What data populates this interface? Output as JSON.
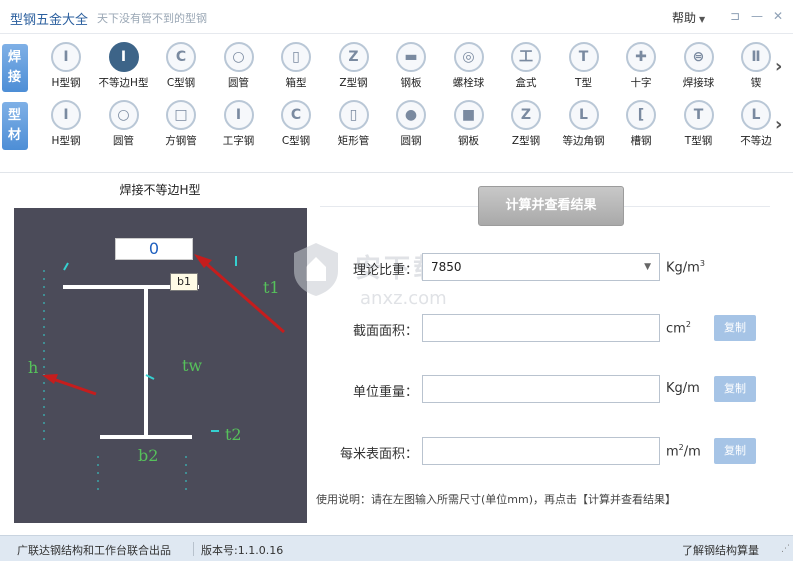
{
  "window": {
    "title": "型钢五金大全",
    "slogan": "天下没有管不到的型钢",
    "help_label": "帮助",
    "controls": [
      "menu-icon",
      "minimize-icon",
      "close-icon"
    ]
  },
  "categories": [
    {
      "tab": "焊接",
      "items": [
        {
          "label": "H型钢",
          "icon": "I"
        },
        {
          "label": "不等边H型",
          "icon": "I",
          "active": true
        },
        {
          "label": "C型钢",
          "icon": "C"
        },
        {
          "label": "圆管",
          "icon": "○"
        },
        {
          "label": "箱型",
          "icon": "▯"
        },
        {
          "label": "Z型钢",
          "icon": "Z"
        },
        {
          "label": "钢板",
          "icon": "▬"
        },
        {
          "label": "螺栓球",
          "icon": "◎"
        },
        {
          "label": "盒式",
          "icon": "工"
        },
        {
          "label": "T型",
          "icon": "T"
        },
        {
          "label": "十字",
          "icon": "✚"
        },
        {
          "label": "焊接球",
          "icon": "⊜"
        },
        {
          "label": "锲",
          "icon": "Ⅱ"
        }
      ]
    },
    {
      "tab": "型材",
      "items": [
        {
          "label": "H型钢",
          "icon": "I"
        },
        {
          "label": "圆管",
          "icon": "○"
        },
        {
          "label": "方钢管",
          "icon": "□"
        },
        {
          "label": "工字钢",
          "icon": "I"
        },
        {
          "label": "C型钢",
          "icon": "C"
        },
        {
          "label": "矩形管",
          "icon": "▯"
        },
        {
          "label": "圆钢",
          "icon": "●"
        },
        {
          "label": "钢板",
          "icon": "■"
        },
        {
          "label": "Z型钢",
          "icon": "Z"
        },
        {
          "label": "等边角钢",
          "icon": "L"
        },
        {
          "label": "槽钢",
          "icon": "["
        },
        {
          "label": "T型钢",
          "icon": "T"
        },
        {
          "label": "不等边",
          "icon": "L"
        }
      ]
    }
  ],
  "diagram": {
    "title": "焊接不等边H型",
    "b1_value": "0",
    "tooltip": "b1",
    "labels": {
      "t1": "t1",
      "h": "h",
      "tw": "tw",
      "t2": "t2",
      "b2": "b2"
    }
  },
  "calc": {
    "button_label": "计算并查看结果",
    "density": {
      "label": "理论比重：",
      "value": "7850",
      "unit_base": "Kg/m",
      "unit_sup": "3"
    },
    "area": {
      "label": "截面面积：",
      "value": "",
      "unit_base": "cm",
      "unit_sup": "2",
      "copy": "复制"
    },
    "weight": {
      "label": "单位重量：",
      "value": "",
      "unit": "Kg/m",
      "copy": "复制"
    },
    "surface": {
      "label": "每米表面积：",
      "value": "",
      "unit_base": "m",
      "unit_sup": "2",
      "unit_tail": "/m",
      "copy": "复制"
    },
    "usage": "使用说明：请在左图输入所需尺寸(单位mm)，再点击【计算并查看结果】"
  },
  "watermark": {
    "text": "安下载",
    "url": "anxz.com"
  },
  "status": {
    "left": "广联达钢结构和工作台联合出品",
    "version": "版本号:1.1.0.16",
    "right": "了解钢结构算量"
  },
  "colors": {
    "accent": "#4d8ed6",
    "active_icon": "#3d6488",
    "diagram_bg": "#4b4b59",
    "dimension_green": "#56c15b",
    "dimension_cyan": "#35d0d0",
    "arrow_red": "#c51d1d",
    "copy_button": "#a6c4e6"
  }
}
